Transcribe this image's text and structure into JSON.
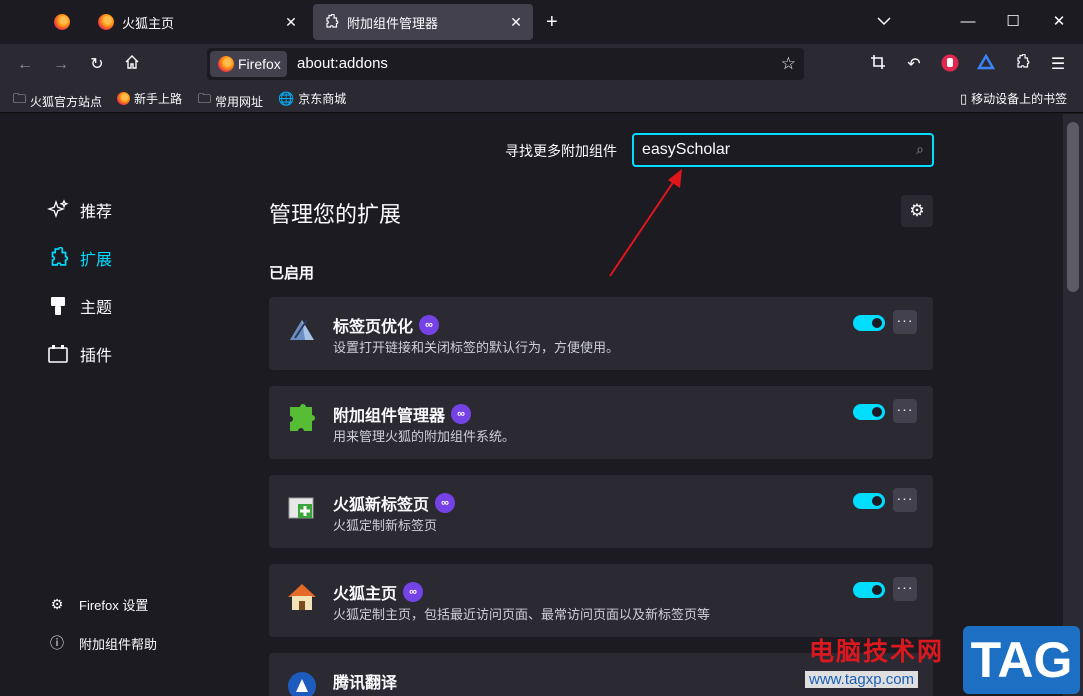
{
  "tabs": [
    {
      "label": ""
    },
    {
      "label": "火狐主页"
    },
    {
      "label": "附加组件管理器"
    }
  ],
  "window_controls": {
    "minimize": "—",
    "maximize": "☐",
    "close": "✕"
  },
  "navbar": {
    "identity_label": "Firefox",
    "url": "about:addons"
  },
  "bookmarks": [
    {
      "label": "火狐官方站点",
      "icon": "folder-icon"
    },
    {
      "label": "新手上路",
      "icon": "firefox-icon"
    },
    {
      "label": "常用网址",
      "icon": "folder-icon"
    },
    {
      "label": "京东商城",
      "icon": "globe-icon"
    },
    {
      "label": "移动设备上的书签",
      "icon": "mobile-icon"
    }
  ],
  "search": {
    "label": "寻找更多附加组件",
    "value": "easyScholar"
  },
  "sidebar": {
    "items": [
      {
        "label": "推荐",
        "icon": "sparkle-icon"
      },
      {
        "label": "扩展",
        "icon": "puzzle-icon"
      },
      {
        "label": "主题",
        "icon": "brush-icon"
      },
      {
        "label": "插件",
        "icon": "plugin-icon"
      }
    ],
    "footer": [
      {
        "label": "Firefox 设置",
        "icon": "gear-icon"
      },
      {
        "label": "附加组件帮助",
        "icon": "help-icon"
      }
    ]
  },
  "main": {
    "title": "管理您的扩展",
    "section": "已启用",
    "extensions": [
      {
        "name": "标签页优化",
        "desc": "设置打开链接和关闭标签的默认行为，方便使用。",
        "enabled": true
      },
      {
        "name": "附加组件管理器",
        "desc": "用来管理火狐的附加组件系统。",
        "enabled": true
      },
      {
        "name": "火狐新标签页",
        "desc": "火狐定制新标签页",
        "enabled": true
      },
      {
        "name": "火狐主页",
        "desc": "火狐定制主页，包括最近访问页面、最常访问页面以及新标签页等",
        "enabled": true
      },
      {
        "name": "腾讯翻译",
        "desc": "",
        "enabled": true
      }
    ]
  },
  "watermark": {
    "site_name": "电脑技术网",
    "url": "www.tagxp.com",
    "logo": "TAG"
  },
  "colors": {
    "accent": "#00ddff",
    "badge": "#7542e5",
    "arrow": "#e0161b"
  }
}
